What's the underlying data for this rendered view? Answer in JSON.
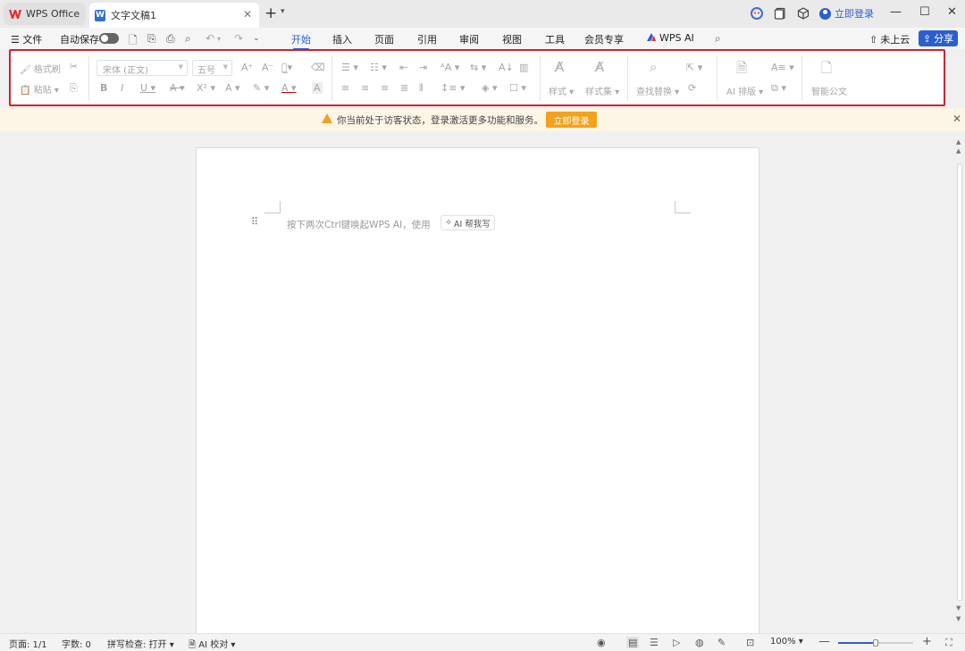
{
  "titlebar": {
    "home_tab": "WPS Office",
    "doc_tab": "文字文稿1",
    "doc_icon_letter": "W",
    "login": "立即登录"
  },
  "menubar": {
    "file": "文件",
    "autosave": "自动保存",
    "tabs": [
      "开始",
      "插入",
      "页面",
      "引用",
      "审阅",
      "视图",
      "工具",
      "会员专享",
      "WPS AI"
    ],
    "active_tab": "开始",
    "cloud": "未上云",
    "share": "分享"
  },
  "ribbon": {
    "format_painter": "格式刷",
    "paste": "粘贴",
    "font_name": "宋体 (正文)",
    "font_size": "五号",
    "style": "样式",
    "style_set": "样式集",
    "find_replace": "查找替换",
    "ai_layout": "AI 排版",
    "smart_doc": "智能公文"
  },
  "notice": {
    "text": "你当前处于访客状态，登录激活更多功能和服务。",
    "button": "立即登录"
  },
  "document": {
    "hint": "按下两次Ctrl键唤起WPS AI，使用",
    "ai_chip": "AI 帮我写"
  },
  "statusbar": {
    "page": "页面: 1/1",
    "words": "字数: 0",
    "spell": "拼写检查: 打开",
    "ai_check": "AI 校对",
    "zoom": "100%",
    "zoom_level": 0.5
  },
  "colors": {
    "accent": "#2b5fcf",
    "highlight_border": "#d8202c",
    "notice_button": "#f3a21c"
  }
}
